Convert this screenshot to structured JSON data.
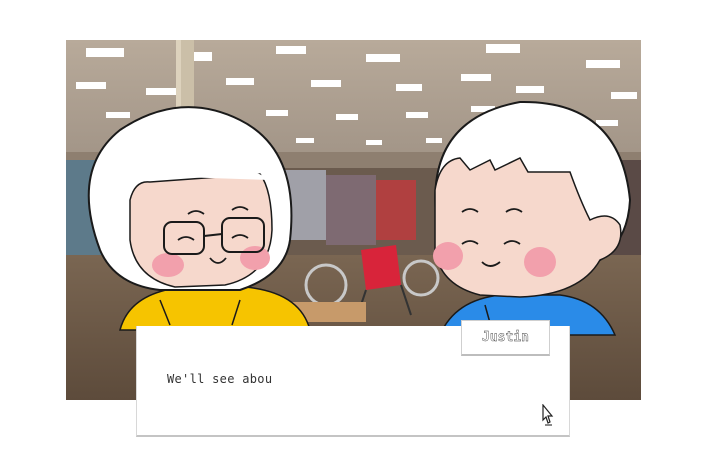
{
  "dialog": {
    "speaker": "Justin",
    "text": "We'll see abou"
  },
  "characters": [
    {
      "role": "left-character",
      "shirt_color": "#f6c400"
    },
    {
      "role": "right-character",
      "shirt_color": "#2a8be8"
    }
  ],
  "icons": {
    "advance": "pointer-hand-icon"
  },
  "colors": {
    "skin": "#f6d8cc",
    "blush": "#f2a0ac",
    "hair": "#ffffff",
    "outline": "#1a1a1a"
  }
}
